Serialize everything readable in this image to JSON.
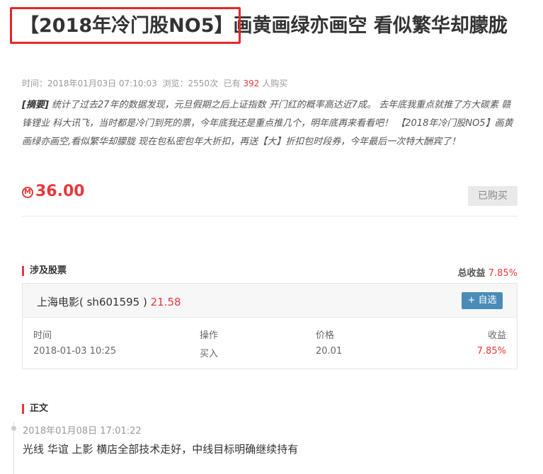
{
  "article": {
    "title": "【2018年冷门股NO5】画黄画绿亦画空 看似繁华却朦胧",
    "meta_time_label": "时间：",
    "meta_time": "2018年01月03日 07:10:03",
    "meta_views_label": "浏览：",
    "meta_views": "2550次",
    "meta_bought_prefix": "已有",
    "meta_bought_count": "392",
    "meta_bought_suffix": "人购买",
    "summary_tag": "[摘要]",
    "summary_text": "统计了过去27年的数据发现，元旦假期之后上证指数 开门红的概率高达近7成。 去年底我重点就推了方大碳素 赣锋锂业 科大讯飞，当时都是冷门到死的票，今年底我还是重点推几个，明年底再来看看吧！ 【2018年冷门股NO5】画黄画绿亦画空,看似繁华却朦胧 现在包私密包年大折扣，再送【大】折扣包时段券，今年最后一次特大酬宾了！",
    "price": "36.00",
    "coin_symbol": "M",
    "bought_button": "已购买"
  },
  "stocks": {
    "section_title": "涉及股票",
    "total_label": "总收益",
    "total_value": "7.85%",
    "stock_name": "上海电影( sh601595 )",
    "stock_price": "21.58",
    "add_button": "+ 自选",
    "columns": [
      "时间",
      "操作",
      "价格",
      "收益"
    ],
    "row": {
      "time": "2018-01-03 10:25",
      "action": "买入",
      "price": "20.01",
      "gain": "7.85%"
    }
  },
  "body": {
    "section_title": "正文",
    "post_time": "2018年01月08日 17:01:22",
    "post_text": "光线 华谊 上影 横店全部技术走好，中线目标明确继续持有"
  },
  "colors": {
    "accent_red": "#e4393c",
    "highlight_box": "#e4262b",
    "button_blue": "#4a8bb8"
  }
}
